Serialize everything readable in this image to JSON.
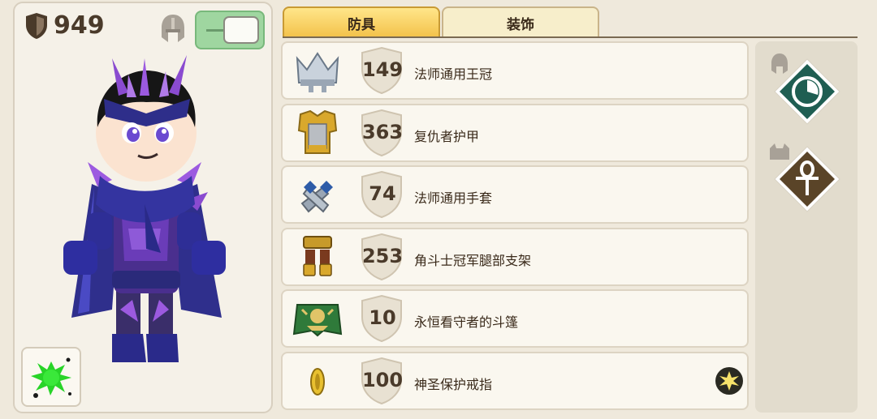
{
  "character": {
    "armor_total": "949"
  },
  "tabs": [
    {
      "label": "防具",
      "active": true
    },
    {
      "label": "装饰",
      "active": false
    }
  ],
  "items": [
    {
      "armor": "149",
      "name": "法师通用王冠",
      "icon": "crown-icon"
    },
    {
      "armor": "363",
      "name": "复仇者护甲",
      "icon": "chestplate-icon"
    },
    {
      "armor": "74",
      "name": "法师通用手套",
      "icon": "gloves-icon"
    },
    {
      "armor": "253",
      "name": "角斗士冠军腿部支架",
      "icon": "leg-braces-icon"
    },
    {
      "armor": "10",
      "name": "永恒看守者的斗篷",
      "icon": "cloak-icon"
    },
    {
      "armor": "100",
      "name": "神圣保护戒指",
      "icon": "ring-icon",
      "enchant": "sun-enchant-icon"
    }
  ],
  "side_abilities": [
    {
      "icon": "clock-icon",
      "color": "#1f5e52"
    },
    {
      "icon": "ankh-icon",
      "color": "#5a4428"
    }
  ],
  "colors": {
    "tab_active": "#f3c24a",
    "toggle_on": "#9fd6a0",
    "text": "#4a3a2a"
  }
}
